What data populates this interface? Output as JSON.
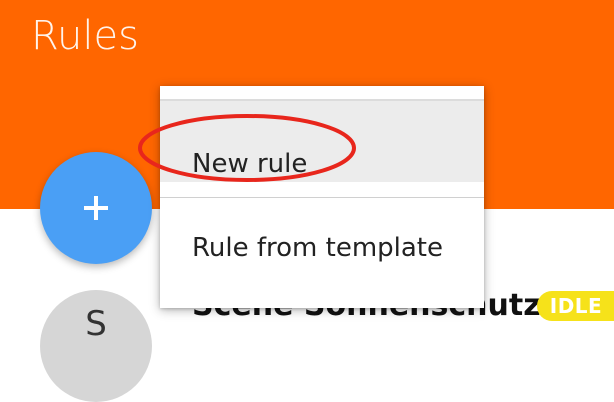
{
  "header": {
    "title": "Rules"
  },
  "fab": {
    "icon": "plus-icon"
  },
  "context_menu": {
    "items": [
      {
        "label": "New rule",
        "highlighted": true
      },
      {
        "label": "Rule from template",
        "highlighted": false
      }
    ]
  },
  "rules_list": {
    "items": [
      {
        "avatar_letter": "S",
        "title": "Scene Sonnenschutz",
        "status": "IDLE"
      }
    ]
  },
  "colors": {
    "header_bg": "#ff6600",
    "fab_bg": "#4a9ff5",
    "status_badge_bg": "#f6e21a",
    "annotation": "#e8261c"
  }
}
